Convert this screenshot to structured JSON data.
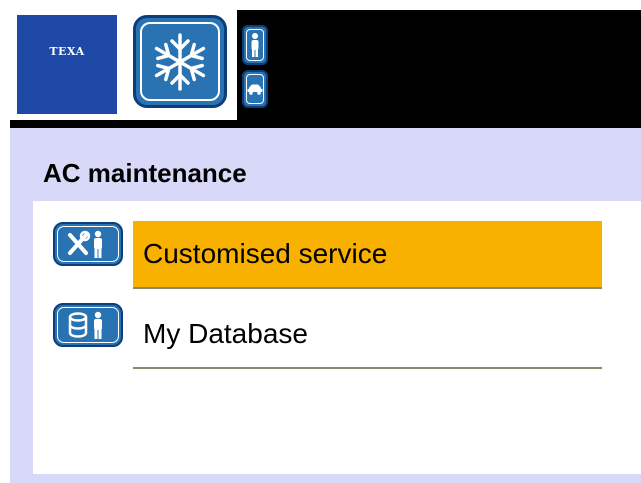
{
  "header": {
    "logo_text": "TEXA",
    "main_icon": "snowflake-icon",
    "side_icons": [
      "person-icon",
      "car-icon"
    ]
  },
  "page": {
    "title": "AC maintenance"
  },
  "menu": {
    "items": [
      {
        "label": "Customised service",
        "icon": "tools-person-icon",
        "selected": true
      },
      {
        "label": "My Database",
        "icon": "database-person-icon",
        "selected": false
      }
    ]
  },
  "colors": {
    "selected_bg": "#f9b100",
    "background": "#d8d8f8",
    "brand_blue": "#1f49a6",
    "icon_blue": "#2a73b3"
  }
}
